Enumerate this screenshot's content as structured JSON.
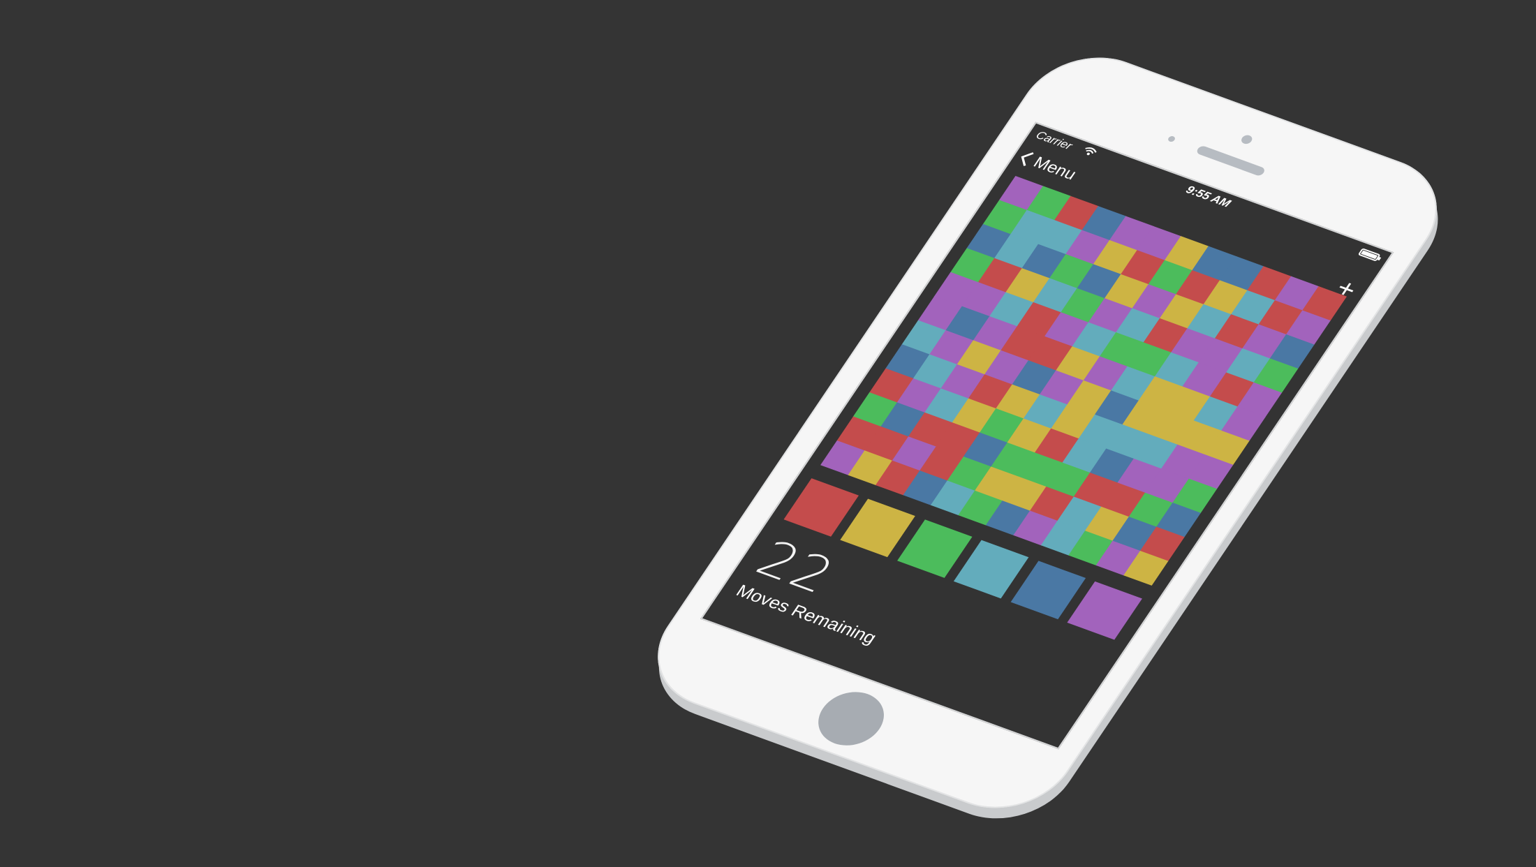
{
  "status_bar": {
    "carrier": "Carrier",
    "time": "9:55 AM"
  },
  "nav": {
    "back_label": "Menu",
    "add_label": "+"
  },
  "game": {
    "moves_remaining": "22",
    "moves_label": "Moves Remaining",
    "colors": {
      "red": "#c44c4c",
      "yellow": "#cdb444",
      "green": "#4cbc5c",
      "cyan": "#63acbc",
      "blue": "#4a78a4",
      "purple": "#a263bc"
    },
    "palette": [
      "red",
      "yellow",
      "green",
      "cyan",
      "blue",
      "purple"
    ],
    "board": [
      [
        "purple",
        "green",
        "red",
        "blue",
        "purple",
        "purple",
        "yellow",
        "blue",
        "blue",
        "red",
        "purple",
        "red"
      ],
      [
        "green",
        "cyan",
        "cyan",
        "purple",
        "yellow",
        "red",
        "green",
        "red",
        "yellow",
        "cyan",
        "red",
        "purple"
      ],
      [
        "blue",
        "cyan",
        "blue",
        "green",
        "blue",
        "yellow",
        "purple",
        "yellow",
        "cyan",
        "red",
        "purple",
        "blue"
      ],
      [
        "green",
        "red",
        "yellow",
        "cyan",
        "green",
        "purple",
        "cyan",
        "red",
        "purple",
        "purple",
        "cyan",
        "green"
      ],
      [
        "purple",
        "purple",
        "cyan",
        "red",
        "purple",
        "cyan",
        "green",
        "green",
        "cyan",
        "purple",
        "red",
        "purple"
      ],
      [
        "purple",
        "blue",
        "purple",
        "red",
        "red",
        "yellow",
        "purple",
        "cyan",
        "yellow",
        "yellow",
        "cyan",
        "purple"
      ],
      [
        "cyan",
        "purple",
        "yellow",
        "purple",
        "blue",
        "purple",
        "yellow",
        "blue",
        "yellow",
        "yellow",
        "yellow",
        "yellow"
      ],
      [
        "blue",
        "cyan",
        "purple",
        "red",
        "yellow",
        "cyan",
        "yellow",
        "cyan",
        "cyan",
        "cyan",
        "purple",
        "purple"
      ],
      [
        "red",
        "purple",
        "cyan",
        "yellow",
        "green",
        "yellow",
        "red",
        "cyan",
        "blue",
        "purple",
        "purple",
        "green"
      ],
      [
        "green",
        "blue",
        "red",
        "red",
        "blue",
        "green",
        "green",
        "green",
        "red",
        "red",
        "green",
        "blue"
      ],
      [
        "red",
        "red",
        "purple",
        "red",
        "green",
        "yellow",
        "yellow",
        "red",
        "cyan",
        "yellow",
        "blue",
        "red"
      ],
      [
        "purple",
        "yellow",
        "red",
        "blue",
        "cyan",
        "green",
        "blue",
        "purple",
        "cyan",
        "green",
        "purple",
        "yellow"
      ]
    ]
  }
}
